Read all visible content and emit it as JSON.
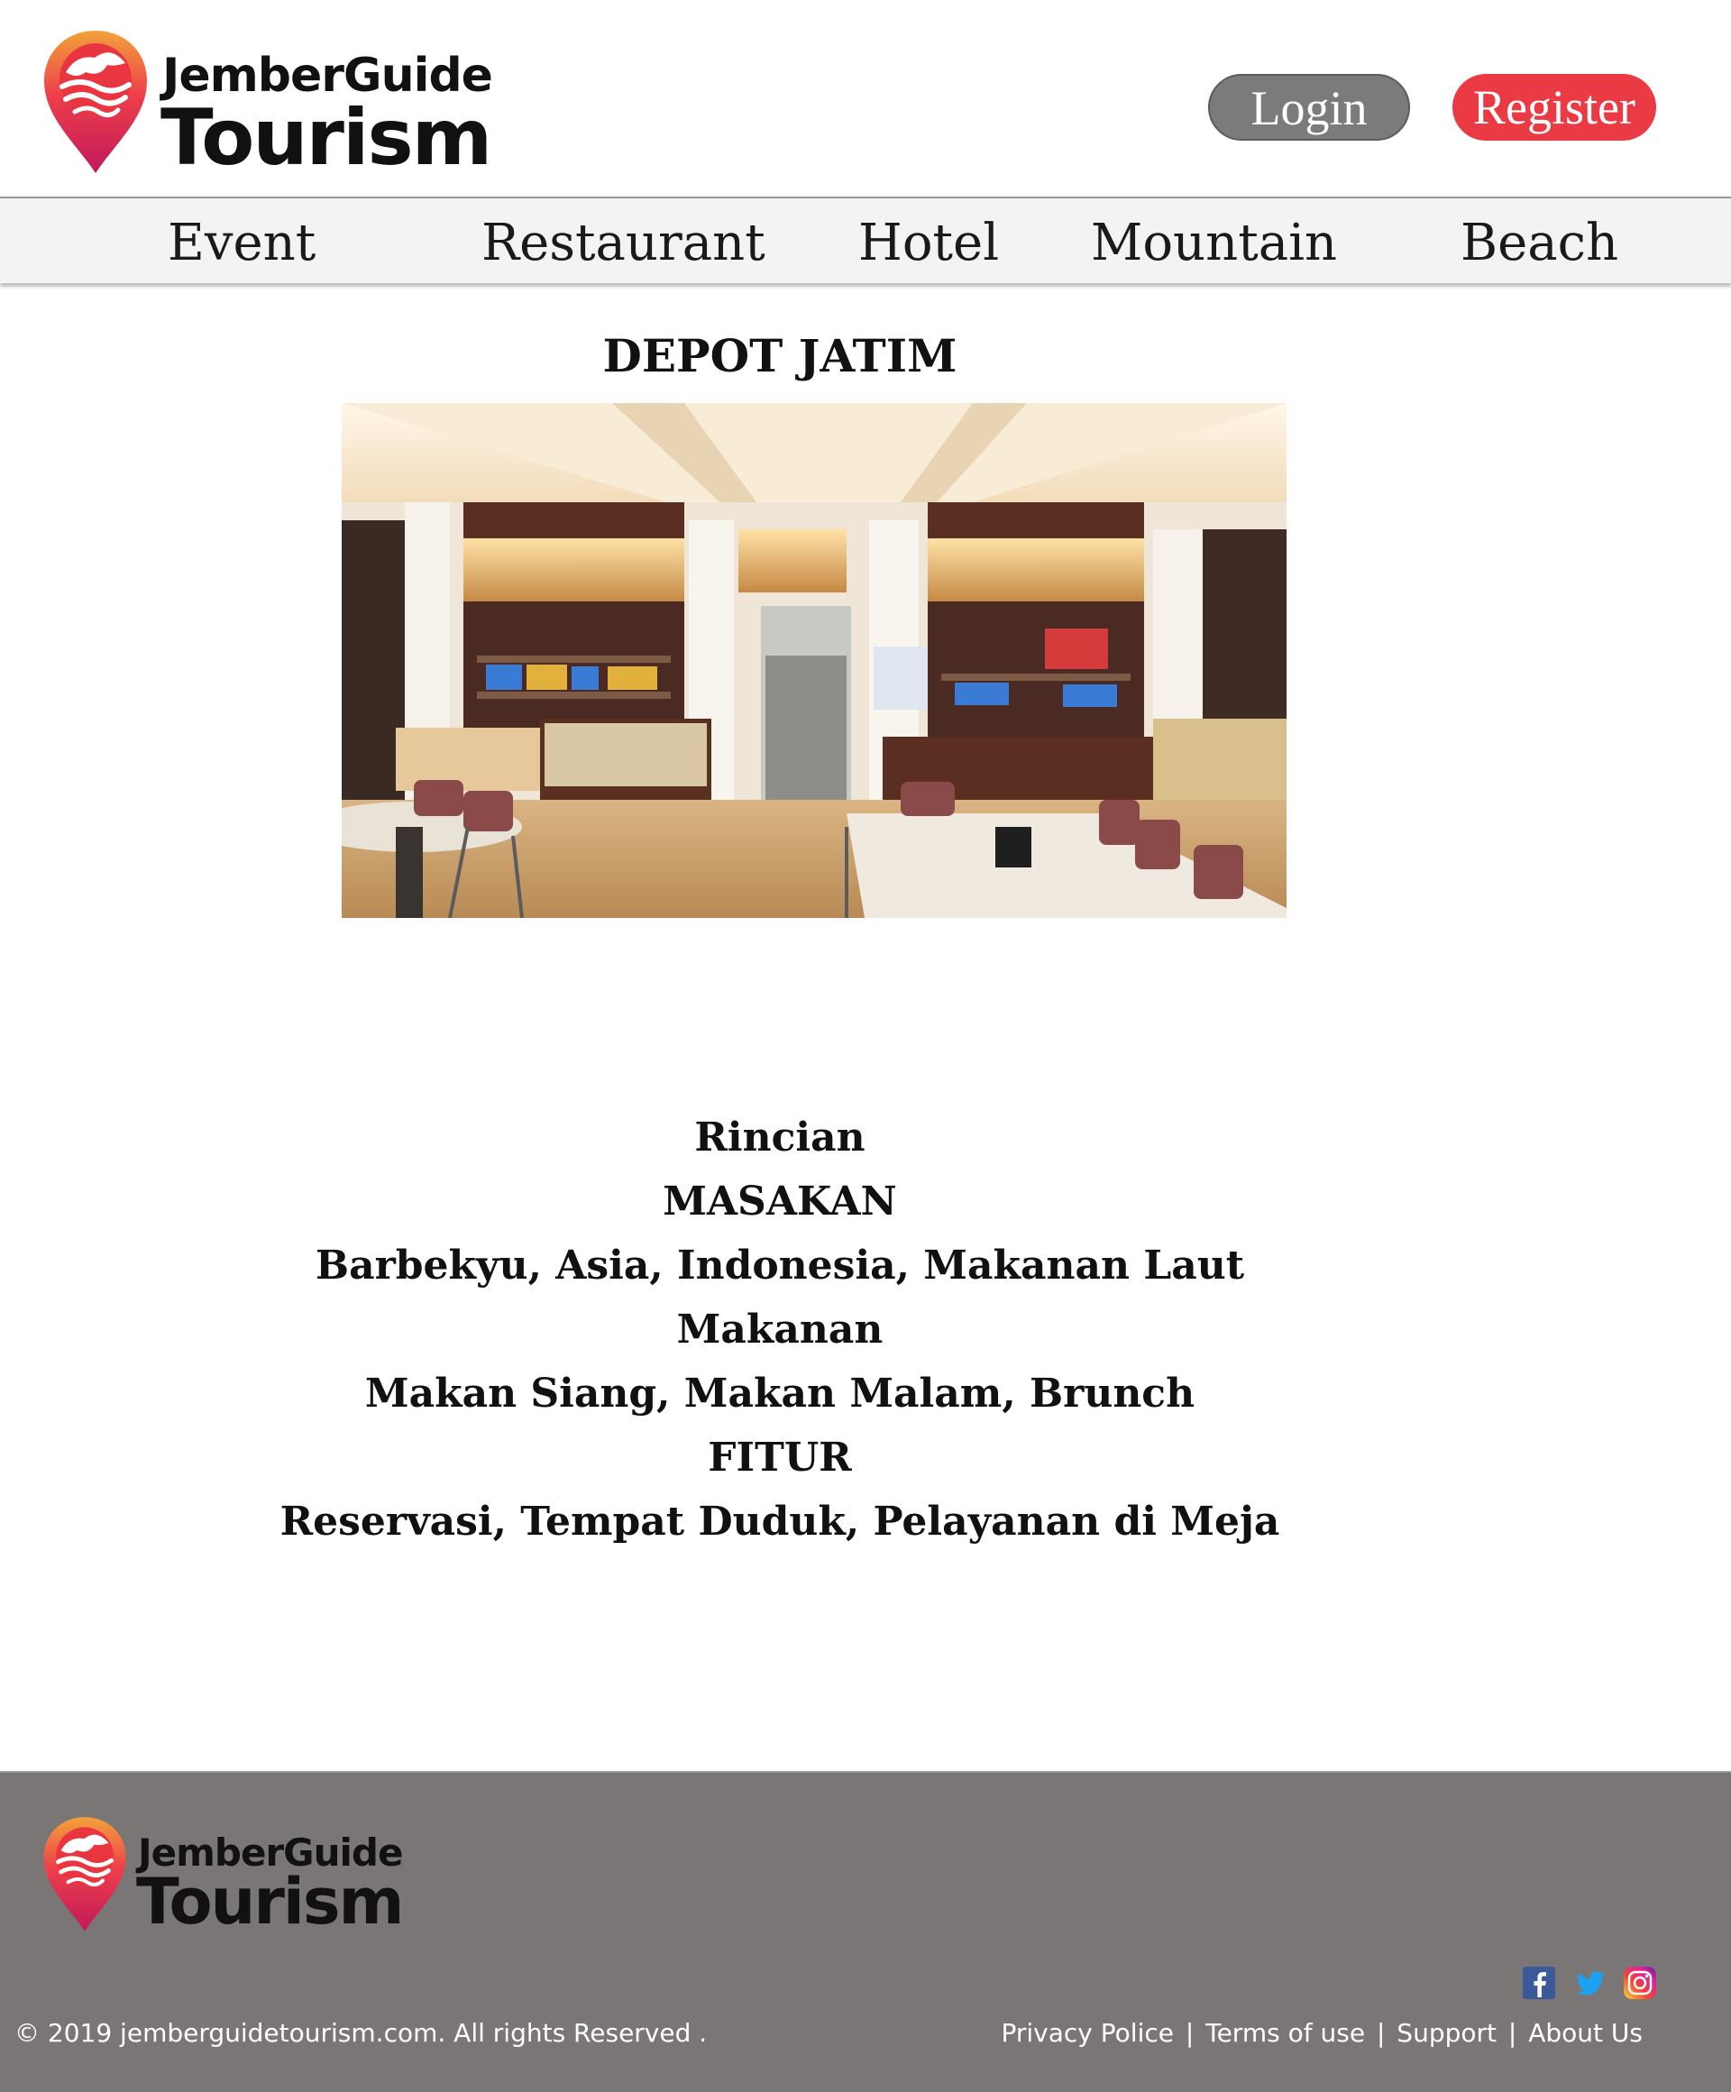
{
  "brand": {
    "name_line1": "JemberGuide",
    "name_line2": "Tourism",
    "colors": {
      "pin_top": "#f2a23a",
      "pin_mid": "#ee3f4a",
      "pin_bottom": "#c2185b"
    }
  },
  "header": {
    "login_label": "Login",
    "register_label": "Register"
  },
  "nav": {
    "items": [
      {
        "label": "Event"
      },
      {
        "label": "Restaurant"
      },
      {
        "label": "Hotel"
      },
      {
        "label": "Mountain"
      },
      {
        "label": "Beach"
      }
    ]
  },
  "main": {
    "title": "DEPOT JATIM",
    "photo_alt": "restaurant-interior-photo",
    "details": {
      "heading": "Rincian",
      "cuisine_label": "MASAKAN",
      "cuisine_value": "Barbekyu, Asia, Indonesia, Makanan Laut",
      "meals_label": "Makanan",
      "meals_value": "Makan Siang, Makan Malam, Brunch",
      "features_label": "FITUR",
      "features_value": "Reservasi, Tempat Duduk, Pelayanan di Meja"
    }
  },
  "footer": {
    "copyright": "© 2019 jemberguidetourism.com. All rights Reserved .",
    "links": {
      "privacy": "Privacy Police",
      "terms": "Terms of use",
      "support": "Support",
      "about": "About Us",
      "separator": "|"
    },
    "social": [
      {
        "icon": "facebook-icon",
        "color": "#3b5998"
      },
      {
        "icon": "twitter-icon",
        "color": "#1da1f2"
      },
      {
        "icon": "instagram-icon",
        "color": "#d6249f"
      }
    ],
    "background_color": "#7a7676"
  }
}
